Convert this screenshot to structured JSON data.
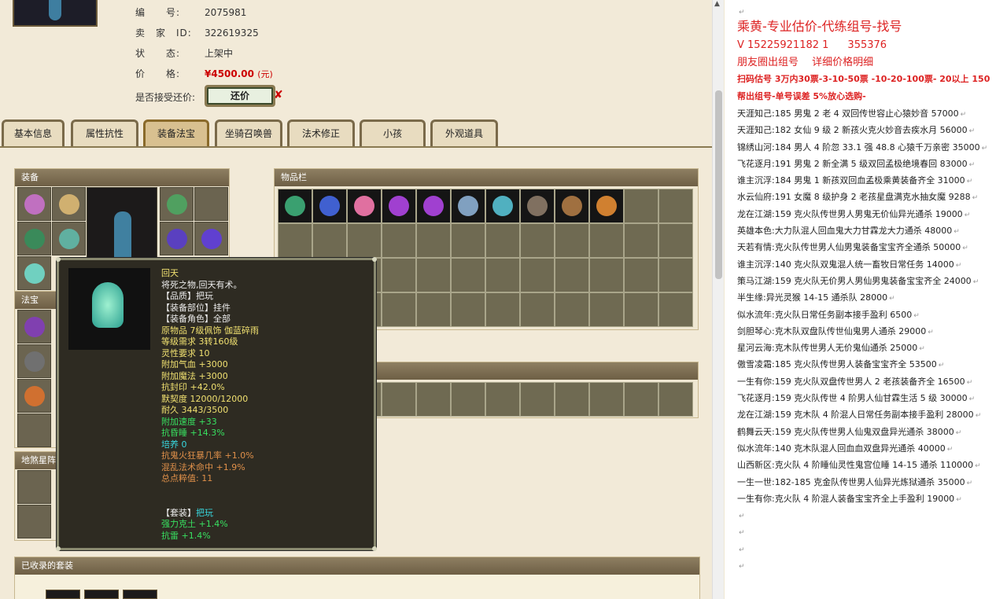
{
  "seller_info": {
    "number_label": "编　　号:",
    "number": "2075981",
    "seller_label": "卖　家　ID:",
    "seller_id": "322619325",
    "status_label": "状　　态:",
    "status": "上架中",
    "price_label": "价　　格:",
    "price": "¥4500.00",
    "price_unit": "(元)",
    "counter_offer_label": "是否接受还价:",
    "counter_offer_button": "还价"
  },
  "tabs": [
    "基本信息",
    "属性抗性",
    "装备法宝",
    "坐骑召唤兽",
    "法术修正",
    "小孩",
    "外观道具"
  ],
  "active_tab": 2,
  "panels": {
    "equipment": "装备",
    "magic_treasure": "法宝",
    "earth_star": "地煞星阵",
    "inventory": "物品栏",
    "collected_sets": "已收录的套装"
  },
  "tooltip": {
    "lines": [
      {
        "text": "回天",
        "color": "yellow"
      },
      {
        "text": "将死之物,回天有术。",
        "color": "white"
      },
      {
        "text": "【品质】把玩",
        "color": "white"
      },
      {
        "text": "【装备部位】挂件",
        "color": "white"
      },
      {
        "text": "【装备角色】全部",
        "color": "white"
      },
      {
        "text": "原物品 7级佩饰 伽蓝碎雨",
        "color": "yellow"
      },
      {
        "text": "等级需求 3转160级",
        "color": "yellow"
      },
      {
        "text": "灵性要求 10",
        "color": "yellow"
      },
      {
        "text": "附加气血 +3000",
        "color": "yellow"
      },
      {
        "text": "附加魔法 +3000",
        "color": "yellow"
      },
      {
        "text": "抗封印 +42.0%",
        "color": "yellow"
      },
      {
        "text": "默契度 12000/12000",
        "color": "yellow"
      },
      {
        "text": "耐久 3443/3500",
        "color": "yellow"
      },
      {
        "text": "附加速度 +33",
        "color": "green"
      },
      {
        "text": "抗昏睡 +14.3%",
        "color": "green"
      },
      {
        "text": "培养 0",
        "color": "cyan"
      },
      {
        "text": "抗鬼火狂暴几率 +1.0%",
        "color": "orange"
      },
      {
        "text": "混乱法术命中 +1.9%",
        "color": "orange"
      },
      {
        "text": "总点粹值: 11",
        "color": "orange"
      },
      {
        "text": "",
        "color": "white"
      },
      {
        "text": "",
        "color": "white"
      },
      {
        "text": "【套装】把玩",
        "color": "white",
        "accent": "把玩"
      },
      {
        "text": "强力克土 +1.4%",
        "color": "green"
      },
      {
        "text": "抗雷 +1.4%",
        "color": "green"
      }
    ]
  },
  "right_panel": {
    "title": "乘黄-专业估价-代练组号-找号",
    "contact": "V 15225921182  1",
    "contact2": "355376",
    "subtitle": "朋友圈出组号 　详细价格明细",
    "promo1": "扫码估号 3万内30票-3-10-50票 -10-20-100票- 20以上 150",
    "promo2": "帮出组号-单号误差 5%放心选购-",
    "listings": [
      "天涯知己:185 男鬼 2 老 4 双回传世容止心猿妙音 57000",
      "天涯知己:182 女仙 9 级 2 新孩火克火妙音去疾水月 56000",
      "锦绣山河:184 男人 4 阶忽 33.1 强 48.8 心猿千万亲密 35000",
      "飞花逐月:191 男鬼 2 新全满 5 级双回孟极绝境春回 83000",
      "谁主沉浮:184 男鬼 1 新孩双回血孟极乘黄装备齐全 31000",
      "水云仙府:191 女魔 8 级护身 2 老孩星盘满克水抽女魔 9288",
      "龙在江湖:159 克火队传世男人男鬼无价仙异光通杀 19000",
      "英雄本色:大力队混人回血鬼大力甘霖龙大力通杀 48000",
      "天若有情:克火队传世男人仙男鬼装备宝宝齐全通杀 50000",
      "谁主沉浮:140 克火队双鬼混人统一畜牧日常任务 14000",
      "策马江湖:159 克火队无价男人男仙男鬼装备宝宝齐全 24000",
      "半生缘:异光灵猴 14-15 通杀队 28000",
      "似水流年:克火队日常任务副本接手盈利 6500",
      "剑胆琴心:克木队双盘队传世仙鬼男人通杀 29000",
      "星河云海:克木队传世男人无价鬼仙通杀 25000",
      "傲雪凌霜:185 克火队传世男人装备宝宝齐全 53500",
      "一生有你:159 克火队双盘传世男人 2 老孩装备齐全 16500",
      "飞花逐月:159 克火队传世 4 阶男人仙甘霖生活 5 级 30000",
      "龙在江湖:159 克木队 4 阶混人日常任务副本接手盈利 28000",
      "鹤舞云天:159 克火队传世男人仙鬼双盘异光通杀 38000",
      "似水流年:140 克木队混人回血血双盘异光通杀 40000",
      "山西新区:克火队 4 阶睡仙灵性鬼宫位睡 14-15 通杀 110000",
      "一生一世:182-185 克金队传世男人仙异光炼狱通杀 35000",
      "一生有你:克火队 4 阶混人装备宝宝齐全上手盈利 19000"
    ],
    "return_mark": "↵"
  }
}
